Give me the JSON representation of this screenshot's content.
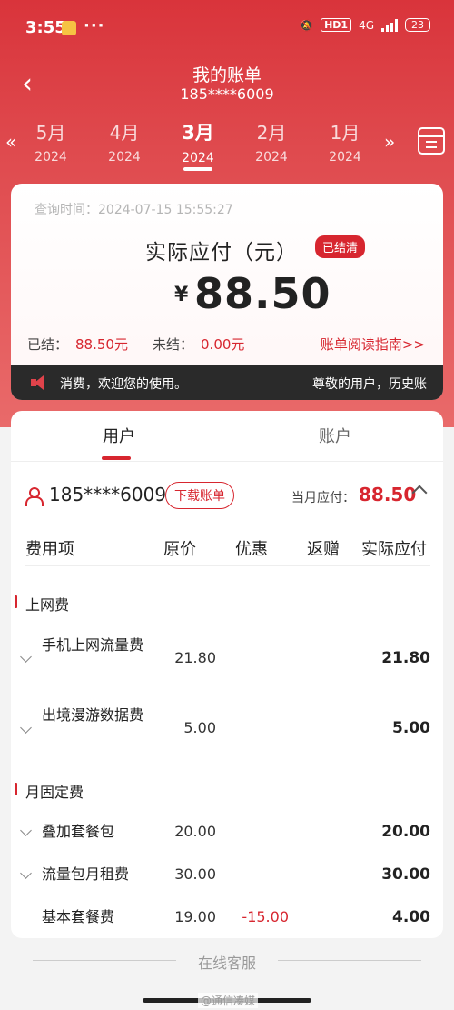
{
  "status_bar": {
    "time": "3:55",
    "more": "···",
    "hd": "HD1",
    "network": "4G",
    "battery": "23"
  },
  "header": {
    "title": "我的账单",
    "subtitle": "185****6009"
  },
  "month_tabs": [
    {
      "month": "5月",
      "year": "2024"
    },
    {
      "month": "4月",
      "year": "2024"
    },
    {
      "month": "3月",
      "year": "2024",
      "active": true
    },
    {
      "month": "2月",
      "year": "2024"
    },
    {
      "month": "1月",
      "year": "2024"
    }
  ],
  "summary": {
    "query_time": "查询时间：2024-07-15 15:55:27",
    "due_title": "实际应付（元）",
    "status_badge": "已结清",
    "currency": "¥",
    "amount": "88.50",
    "settled_label": "已结：",
    "settled_value": "88.50元",
    "unsettled_label": "未结：",
    "unsettled_value": "0.00元",
    "guide_link": "账单阅读指南>>"
  },
  "notice": {
    "left": "消费，欢迎您的使用。",
    "right": "尊敬的用户，历史账"
  },
  "tabs": {
    "user": "用户",
    "account": "账户"
  },
  "account_info": {
    "number": "185****6009",
    "download_button": "下载账单",
    "monthly_label": "当月应付：",
    "monthly_value": "88.50"
  },
  "table_headers": {
    "item": "费用项",
    "original": "原价",
    "discount": "优惠",
    "rebate": "返赠",
    "final": "实际应付"
  },
  "sections": [
    {
      "title": "上网费",
      "rows": [
        {
          "name": "手机上网流量费",
          "original": "21.80",
          "discount": "",
          "final": "21.80"
        },
        {
          "name": "出境漫游数据费",
          "original": "5.00",
          "discount": "",
          "final": "5.00"
        }
      ]
    },
    {
      "title": "月固定费",
      "rows": [
        {
          "name": "叠加套餐包",
          "original": "20.00",
          "discount": "",
          "final": "20.00"
        },
        {
          "name": "流量包月租费",
          "original": "30.00",
          "discount": "",
          "final": "30.00"
        },
        {
          "name": "基本套餐费",
          "original": "19.00",
          "discount": "-15.00",
          "final": "4.00"
        }
      ]
    }
  ],
  "bottom": {
    "customer_service": "在线客服",
    "watermark": "@通信凑媒"
  },
  "colors": {
    "brand_red": "#d7262f",
    "header_gradient_top": "#d9343b",
    "header_gradient_bottom": "#e96a6a"
  }
}
